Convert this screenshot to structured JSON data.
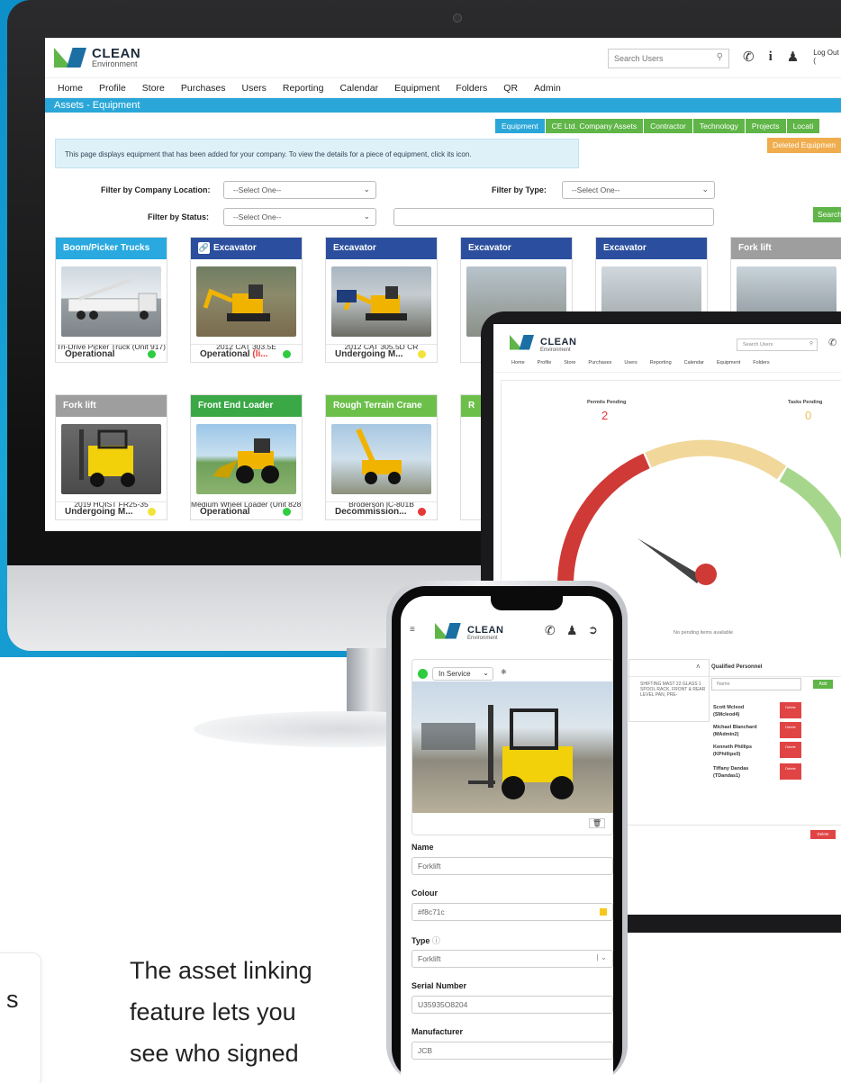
{
  "desktop": {
    "logo": {
      "line1": "CLEAN",
      "line2": "Environment"
    },
    "search_placeholder": "Search Users",
    "logout": "Log Out (",
    "nav": [
      "Home",
      "Profile",
      "Store",
      "Purchases",
      "Users",
      "Reporting",
      "Calendar",
      "Equipment",
      "Folders",
      "QR",
      "Admin"
    ],
    "breadcrumb": "Assets - Equipment",
    "tabs": [
      "Equipment",
      "CE Ltd. Company Assets",
      "Contractor",
      "Technology",
      "Projects",
      "Locati"
    ],
    "info": "This page displays equipment that has been added for your company. To view the details for a piece of equipment, click its icon.",
    "deleted_button": "Deleted Equipmen",
    "filters": {
      "location_label": "Filter by Company Location:",
      "type_label": "Filter by Type:",
      "status_label": "Filter by Status:",
      "select_one": "--Select One--",
      "search_button": "Search"
    },
    "cards": [
      {
        "header": "Boom/Picker Trucks",
        "color": "#29a9df",
        "name": "Tri-Drive Picker Truck (Unit 917)",
        "status": "Operational",
        "status_color": "#2ecc40"
      },
      {
        "header": "Excavator",
        "color": "#2b4f9e",
        "name": "2012 CAT 303.5E",
        "status": "Operational",
        "status_suffix": "(li...",
        "status_color": "#2ecc40"
      },
      {
        "header": "Excavator",
        "color": "#2b4f9e",
        "name": "2012 CAT 305.5D CR",
        "status": "Undergoing M...",
        "status_color": "#f2e33a"
      },
      {
        "header": "Excavator",
        "color": "#2b4f9e",
        "name": "",
        "status": "",
        "status_color": ""
      },
      {
        "header": "Excavator",
        "color": "#2b4f9e",
        "name": "",
        "status": "",
        "status_color": ""
      },
      {
        "header": "Fork lift",
        "color": "#9e9e9e",
        "name": "",
        "status": "",
        "status_color": ""
      },
      {
        "header": "Fork lift",
        "color": "#9e9e9e",
        "name": "2019 HOIST FR25-35",
        "status": "Undergoing M...",
        "status_color": "#f2e33a"
      },
      {
        "header": "Front End Loader",
        "color": "#3aa845",
        "name": "Medium Wheel Loader (Unit 828)",
        "status": "Operational",
        "status_color": "#2ecc40"
      },
      {
        "header": "Rough Terrain Crane",
        "color": "#6cc04a",
        "name": "Broderson IC-801B",
        "status": "Decommission...",
        "status_color": "#e53935"
      },
      {
        "header": "R",
        "color": "#6cc04a",
        "name": "",
        "status": "",
        "status_color": ""
      }
    ]
  },
  "tablet": {
    "logo": {
      "line1": "CLEAN",
      "line2": "Environment"
    },
    "search_placeholder": "Search Users",
    "nav": [
      "Home",
      "Profile",
      "Store",
      "Purchases",
      "Users",
      "Reporting",
      "Calendar",
      "Equipment",
      "Folders"
    ],
    "permits_pending_label": "Permits Pending",
    "permits_pending_value": "2",
    "tasks_pending_label": "Tasks Pending",
    "tasks_pending_value": "0",
    "no_permits": "No pending items available",
    "notes_text": "SHIFTING MAST 22 GLASS 1 SPOOL RACK, FRONT & REAR LEVEL PAN, PRE-",
    "qualified_personnel": "Qualified Personnel",
    "name_placeholder": "Name",
    "add": "Add",
    "people": [
      "Scott Mcleod (SMcleod4)",
      "Michael Blanchard (MAdmin2)",
      "Kenneth Phillips (KPhillips0)",
      "Tiffany Dandas (TDandas1)"
    ],
    "remove": "Delete",
    "save_btn": "Delete"
  },
  "phone": {
    "logo": {
      "line1": "CLEAN",
      "line2": "Environment"
    },
    "status": "In Service",
    "fields": [
      {
        "label": "Name",
        "value": "Forklift"
      },
      {
        "label": "Colour",
        "value": "#f8c71c"
      },
      {
        "label": "Type",
        "value": "Forklift"
      },
      {
        "label": "Serial Number",
        "value": "U35935O8204"
      },
      {
        "label": "Manufacturer",
        "value": "JCB"
      }
    ]
  },
  "caption": {
    "lines": [
      "The asset linking",
      "feature lets you",
      "see who signed"
    ]
  },
  "left_fragment": "s"
}
